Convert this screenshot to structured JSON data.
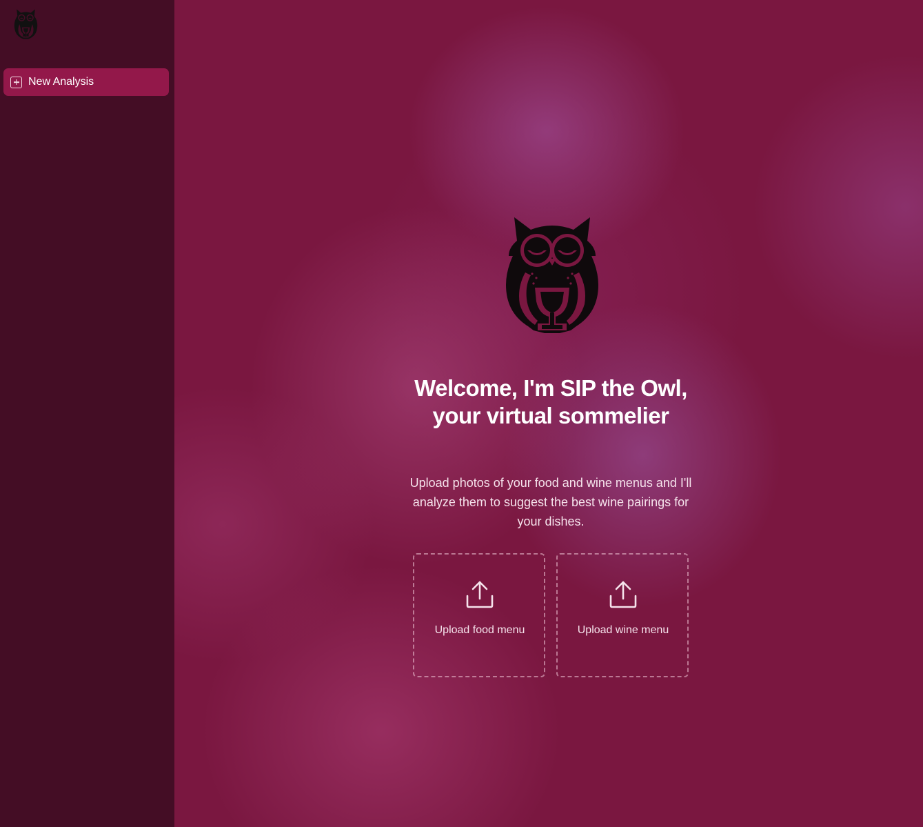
{
  "sidebar": {
    "logo_icon": "owl-logo-icon",
    "new_analysis": {
      "label": "New Analysis",
      "icon": "plus-square-icon"
    }
  },
  "main": {
    "hero_icon": "owl-wine-glass-icon",
    "title": "Welcome, I'm SIP the Owl, your virtual sommelier",
    "description": "Upload photos of your food and wine menus and I'll analyze them to suggest the best wine pairings for your dishes.",
    "uploads": [
      {
        "label": "Upload food menu",
        "icon": "upload-icon"
      },
      {
        "label": "Upload wine menu",
        "icon": "upload-icon"
      }
    ]
  },
  "colors": {
    "sidebar_bg": "#440d25",
    "accent": "#93184a",
    "main_bg": "#7a1740",
    "text": "#ffffff"
  }
}
